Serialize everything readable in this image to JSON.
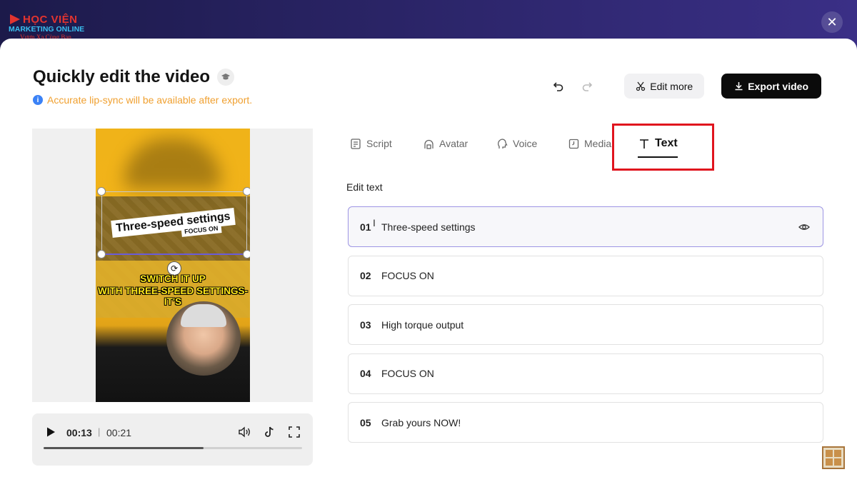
{
  "brand": {
    "line1": "HỌC VIỆN",
    "line2": "MARKETING ONLINE",
    "line3": "Vươn Xa Cùng Bạn"
  },
  "page": {
    "title": "Quickly edit the video",
    "notice": "Accurate lip-sync will be available after export."
  },
  "toolbar": {
    "edit_more_label": "Edit more",
    "export_label": "Export video"
  },
  "preview": {
    "caption_main": "Three-speed settings",
    "caption_sub": "FOCUS ON",
    "subtitle_line1": "SWITCH IT UP",
    "subtitle_line2": "WITH THREE-SPEED SETTINGS-IT'S"
  },
  "player": {
    "current_time": "00:13",
    "separator": "|",
    "total_time": "00:21",
    "progress": 0.62
  },
  "tabs": [
    {
      "label": "Script",
      "icon": "script-icon",
      "active": false
    },
    {
      "label": "Avatar",
      "icon": "avatar-icon",
      "active": false
    },
    {
      "label": "Voice",
      "icon": "voice-icon",
      "active": false
    },
    {
      "label": "Media",
      "icon": "media-icon",
      "active": false
    },
    {
      "label": "Text",
      "icon": "text-icon",
      "active": true
    }
  ],
  "edit_text": {
    "section_label": "Edit text",
    "items": [
      {
        "num": "01",
        "text": "Three-speed settings",
        "selected": true
      },
      {
        "num": "02",
        "text": "FOCUS ON",
        "selected": false
      },
      {
        "num": "03",
        "text": "High torque output",
        "selected": false
      },
      {
        "num": "04",
        "text": "FOCUS ON",
        "selected": false
      },
      {
        "num": "05",
        "text": "Grab yours NOW!",
        "selected": false
      }
    ]
  },
  "colors": {
    "accent_highlight": "#e0141e",
    "notice": "#f0a030",
    "selection": "#9d95e4"
  }
}
